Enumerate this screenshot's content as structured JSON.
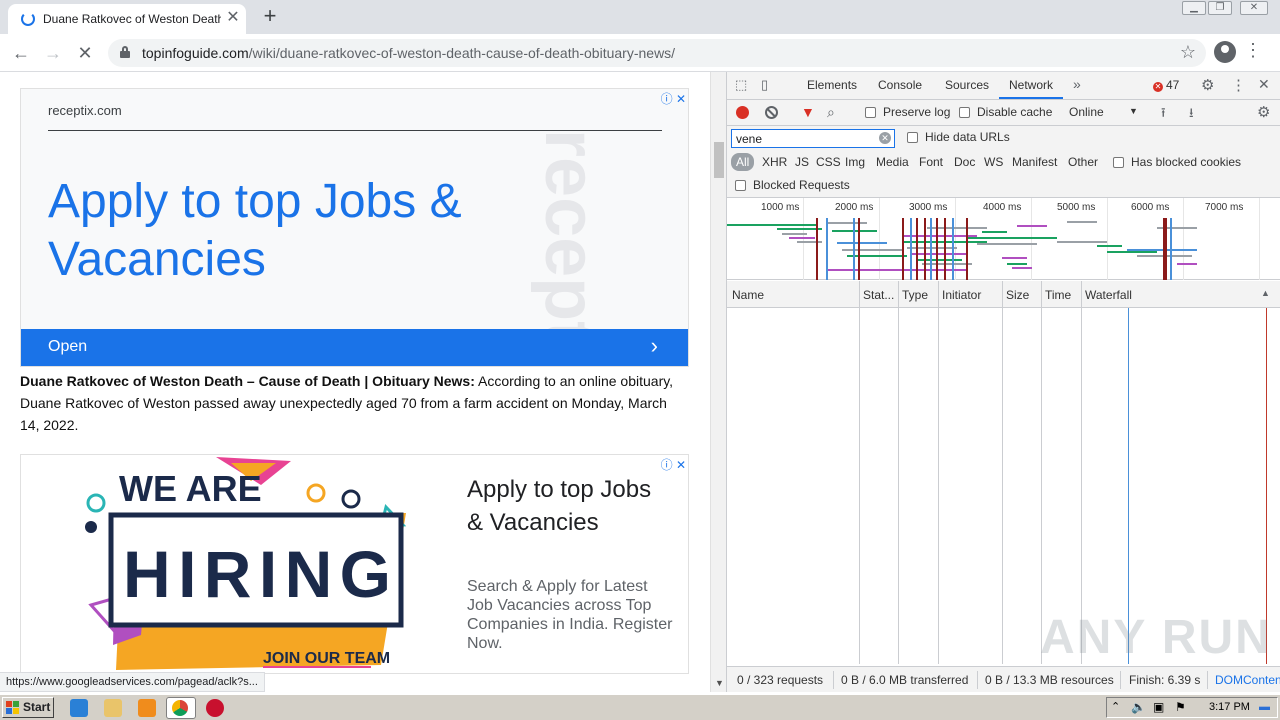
{
  "browser": {
    "tab_title": "Duane Ratkovec of Weston Death –",
    "url_domain": "topinfoguide.com",
    "url_path": "/wiki/duane-ratkovec-of-weston-death-cause-of-death-obituary-news/",
    "status_url": "https://www.googleadservices.com/pagead/aclk?s..."
  },
  "ad1": {
    "choices": "ⓘ ✕",
    "domain": "receptix.com",
    "headline": "Apply to top Jobs & Vacancies",
    "watermark": "receptix",
    "cta": "Open",
    "chevron": "›"
  },
  "article": {
    "title": "Duane Ratkovec of Weston Death – Cause of Death | Obituary News:",
    "body": " According to an online obituary, Duane Ratkovec of Weston passed away unexpectedly aged 70 from a farm accident on Monday, March 14, 2022."
  },
  "ad2": {
    "choices": "ⓘ ✕",
    "image_top": "WE ARE",
    "image_main": "HIRING",
    "image_bottom": "JOIN OUR TEAM",
    "headline": "Apply to top Jobs & Vacancies",
    "description": "Search & Apply for Latest Job Vacancies across Top Companies in India. Register Now."
  },
  "devtools": {
    "tabs": [
      "Elements",
      "Console",
      "Sources",
      "Network"
    ],
    "active_tab": "Network",
    "error_count": "47",
    "toolbar": {
      "preserve_log": "Preserve log",
      "disable_cache": "Disable cache",
      "throttle": "Online"
    },
    "filter": {
      "value": "vene",
      "hide_data_urls": "Hide data URLs",
      "types": [
        "All",
        "XHR",
        "JS",
        "CSS",
        "Img",
        "Media",
        "Font",
        "Doc",
        "WS",
        "Manifest",
        "Other"
      ],
      "has_blocked_cookies": "Has blocked cookies",
      "blocked_requests": "Blocked Requests"
    },
    "timeline_ticks": [
      "1000 ms",
      "2000 ms",
      "3000 ms",
      "4000 ms",
      "5000 ms",
      "6000 ms",
      "7000 ms"
    ],
    "columns": [
      "Name",
      "Stat...",
      "Type",
      "Initiator",
      "Size",
      "Time",
      "Waterfall"
    ],
    "summary": {
      "requests": "0 / 323 requests",
      "transferred": "0 B / 6.0 MB transferred",
      "resources": "0 B / 13.3 MB resources",
      "finish": "Finish: 6.39 s",
      "dom": "DOMContentLoaded"
    }
  },
  "watermark": "ANY RUN",
  "taskbar": {
    "start": "Start",
    "clock": "3:17 PM"
  }
}
